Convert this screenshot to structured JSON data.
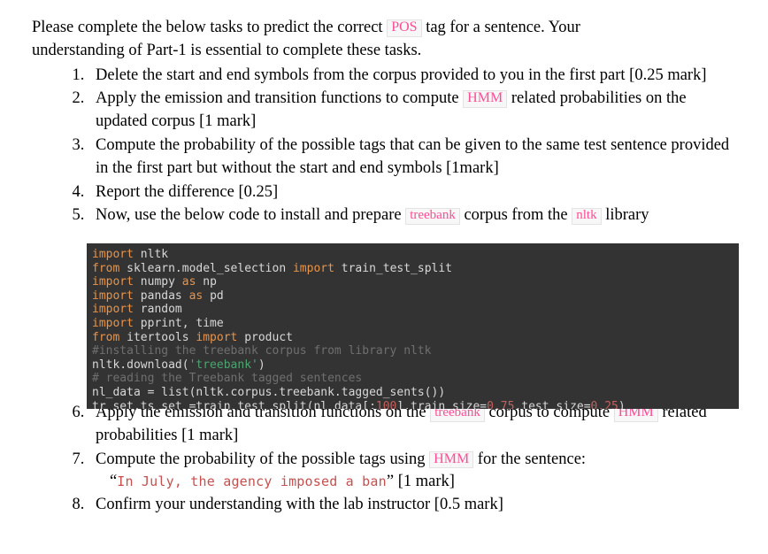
{
  "document": {
    "intro": {
      "part1": "Please complete the below tasks to predict the correct ",
      "chip1": "POS",
      "part2": " tag for a sentence. Your understanding of Part-1 is essential to complete these tasks."
    },
    "tasks": [
      {
        "number": "1.",
        "text": "Delete the start and end symbols from the corpus provided to you in the first part [0.25 mark]"
      },
      {
        "number": "2.",
        "pre": "Apply the emission and transition functions to compute ",
        "chip": "HMM",
        "post": " related probabilities on the updated corpus [1 mark]"
      },
      {
        "number": "3.",
        "text": "Compute the probability of the possible tags that can be given to the same test sentence provided in the first part but without the start and end symbols [1mark]"
      },
      {
        "number": "4.",
        "text": "Report the difference [0.25]"
      },
      {
        "number": "5.",
        "pre": "Now, use the below code to install and prepare ",
        "chip": "treebank",
        "mid": " corpus from the ",
        "chip2": "nltk",
        "post": " library"
      },
      {
        "number": "6.",
        "pre": "Apply the emission and transition functions on the ",
        "chip": "treebank",
        "mid": " corpus to compute ",
        "chip2": "HMM",
        "post": " related probabilities [1 mark]"
      },
      {
        "number": "7.",
        "pre": "Compute the probability of the possible tags using ",
        "chip": "HMM",
        "post": " for the sentence:",
        "quote_open": "“",
        "quote_code": "In July, the agency imposed a ban",
        "quote_close": "”",
        "quote_mark": " [1 mark]"
      },
      {
        "number": "8.",
        "text": "Confirm your understanding with the lab instructor [0.5 mark]"
      }
    ],
    "code_block": {
      "language": "python",
      "lines": [
        [
          {
            "t": "import",
            "c": "k"
          },
          {
            "t": " nltk",
            "c": "id"
          }
        ],
        [
          {
            "t": "from",
            "c": "k"
          },
          {
            "t": " sklearn.model_selection ",
            "c": "id"
          },
          {
            "t": "import",
            "c": "k"
          },
          {
            "t": " train_test_split",
            "c": "id"
          }
        ],
        [
          {
            "t": "import",
            "c": "k"
          },
          {
            "t": " numpy ",
            "c": "id"
          },
          {
            "t": "as",
            "c": "k"
          },
          {
            "t": " np",
            "c": "id"
          }
        ],
        [
          {
            "t": "import",
            "c": "k"
          },
          {
            "t": " pandas ",
            "c": "id"
          },
          {
            "t": "as",
            "c": "k"
          },
          {
            "t": " pd",
            "c": "id"
          }
        ],
        [
          {
            "t": "import",
            "c": "k"
          },
          {
            "t": " random",
            "c": "id"
          }
        ],
        [
          {
            "t": "import",
            "c": "k"
          },
          {
            "t": " pprint, time",
            "c": "id"
          }
        ],
        [
          {
            "t": "from",
            "c": "k"
          },
          {
            "t": " itertools ",
            "c": "id"
          },
          {
            "t": "import",
            "c": "k"
          },
          {
            "t": " product",
            "c": "id"
          }
        ],
        [
          {
            "t": "#installing the treebank corpus from library nltk",
            "c": "cm"
          }
        ],
        [
          {
            "t": "nltk.download(",
            "c": "id"
          },
          {
            "t": "'treebank'",
            "c": "st"
          },
          {
            "t": ")",
            "c": "id"
          }
        ],
        [
          {
            "t": "# reading the Treebank tagged sentences",
            "c": "cm"
          }
        ],
        [
          {
            "t": "nl_data = list(nltk.corpus.treebank.tagged_sents())",
            "c": "id"
          }
        ],
        [
          {
            "t": "tr_set,ts_set =train_test_split(nl_data[:",
            "c": "id"
          },
          {
            "t": "100",
            "c": "nm"
          },
          {
            "t": "],train_size=",
            "c": "id"
          },
          {
            "t": "0.75",
            "c": "nm"
          },
          {
            "t": ",test_size=",
            "c": "id"
          },
          {
            "t": "0.25",
            "c": "nm"
          },
          {
            "t": ")",
            "c": "id"
          }
        ]
      ]
    },
    "colors": {
      "chip_text": "#ff4d94",
      "chip_bg": "#f7f7f7",
      "chip_border": "#e3e3e3",
      "code_bg": "#333333",
      "code_text": "#d8d8d8",
      "code_keyword": "#e8944a",
      "code_comment": "#6f6f6f",
      "code_string": "#4ea371",
      "code_number": "#c4605d",
      "inline_sentence": "#c7504e"
    }
  }
}
